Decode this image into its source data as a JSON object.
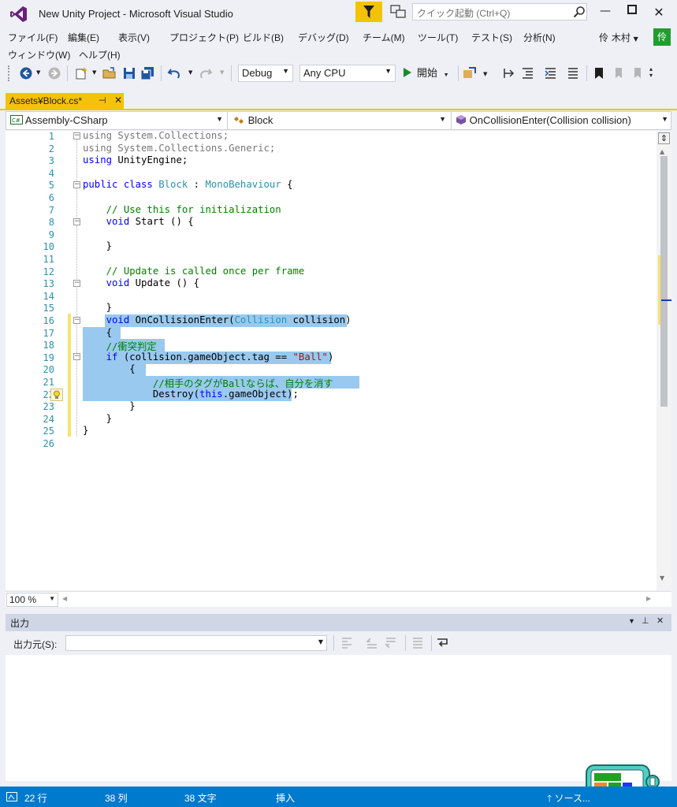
{
  "window": {
    "title": "New Unity Project - Microsoft Visual Studio"
  },
  "quick_launch": {
    "placeholder": "クイック起動 (Ctrl+Q)"
  },
  "menu": {
    "row1": [
      "ファイル(F)",
      "編集(E)",
      "表示(V)",
      "プロジェクト(P)",
      "ビルド(B)",
      "デバッグ(D)",
      "チーム(M)",
      "ツール(T)",
      "テスト(S)",
      "分析(N)"
    ],
    "row2": [
      "ウィンドウ(W)",
      "ヘルプ(H)"
    ],
    "user_name": "伶 木村",
    "avatar_initial": "伶"
  },
  "toolbar": {
    "config": "Debug",
    "platform": "Any CPU",
    "start_label": "開始"
  },
  "tab": {
    "label": "Assets¥Block.cs*",
    "pin": "⊣",
    "close": "✕"
  },
  "navbar": {
    "project": "Assembly-CSharp",
    "class": "Block",
    "member": "OnCollisionEnter(Collision collision)"
  },
  "code": {
    "line_numbers": [
      "1",
      "2",
      "3",
      "4",
      "5",
      "6",
      "7",
      "8",
      "9",
      "10",
      "11",
      "12",
      "13",
      "14",
      "15",
      "16",
      "17",
      "18",
      "19",
      "20",
      "21",
      "22",
      "23",
      "24",
      "25",
      "26"
    ],
    "l1a": "using",
    "l1b": " System.Collections;",
    "l2a": "using",
    "l2b": " System.Collections.Generic;",
    "l3a": "using",
    "l3b": " UnityEngine;",
    "l5a": "public class ",
    "l5b": "Block",
    "l5c": " : ",
    "l5d": "MonoBehaviour",
    "l5e": " {",
    "l7": "    // Use this for initialization",
    "l8a": "    void",
    "l8b": " Start () {",
    "l10": "    }",
    "l12": "    // Update is called once per frame",
    "l13a": "    void",
    "l13b": " Update () {",
    "l15": "    }",
    "l16a": "    void",
    "l16b": " OnCollisionEnter(",
    "l16c": "Collision",
    "l16d": " collision)",
    "l17": "    {",
    "l18": "    //衝突判定",
    "l19a": "    if",
    "l19b": " (collision.gameObject.tag == ",
    "l19c": "\"Ball\"",
    "l19d": ")",
    "l20": "        {",
    "l21": "            //相手のタグがBallならば、自分を消す",
    "l22a": "            Destroy(",
    "l22b": "this",
    "l22c": ".gameObject);",
    "l23": "        }",
    "l24": "    }",
    "l25": "}"
  },
  "zoom": {
    "value": "100 %"
  },
  "output": {
    "title": "出力",
    "source_label": "出力元(S):",
    "source_value": ""
  },
  "status": {
    "line": "22 行",
    "col": "38 列",
    "chars": "38 文字",
    "mode": "挿入",
    "source_control": "ソース..."
  },
  "colors": {
    "accent_yellow": "#f5c20a",
    "status_blue": "#007acc",
    "selection": "#99c9ef",
    "keyword": "#0000ff",
    "type": "#2b91af",
    "comment": "#008000",
    "string": "#a31515"
  }
}
